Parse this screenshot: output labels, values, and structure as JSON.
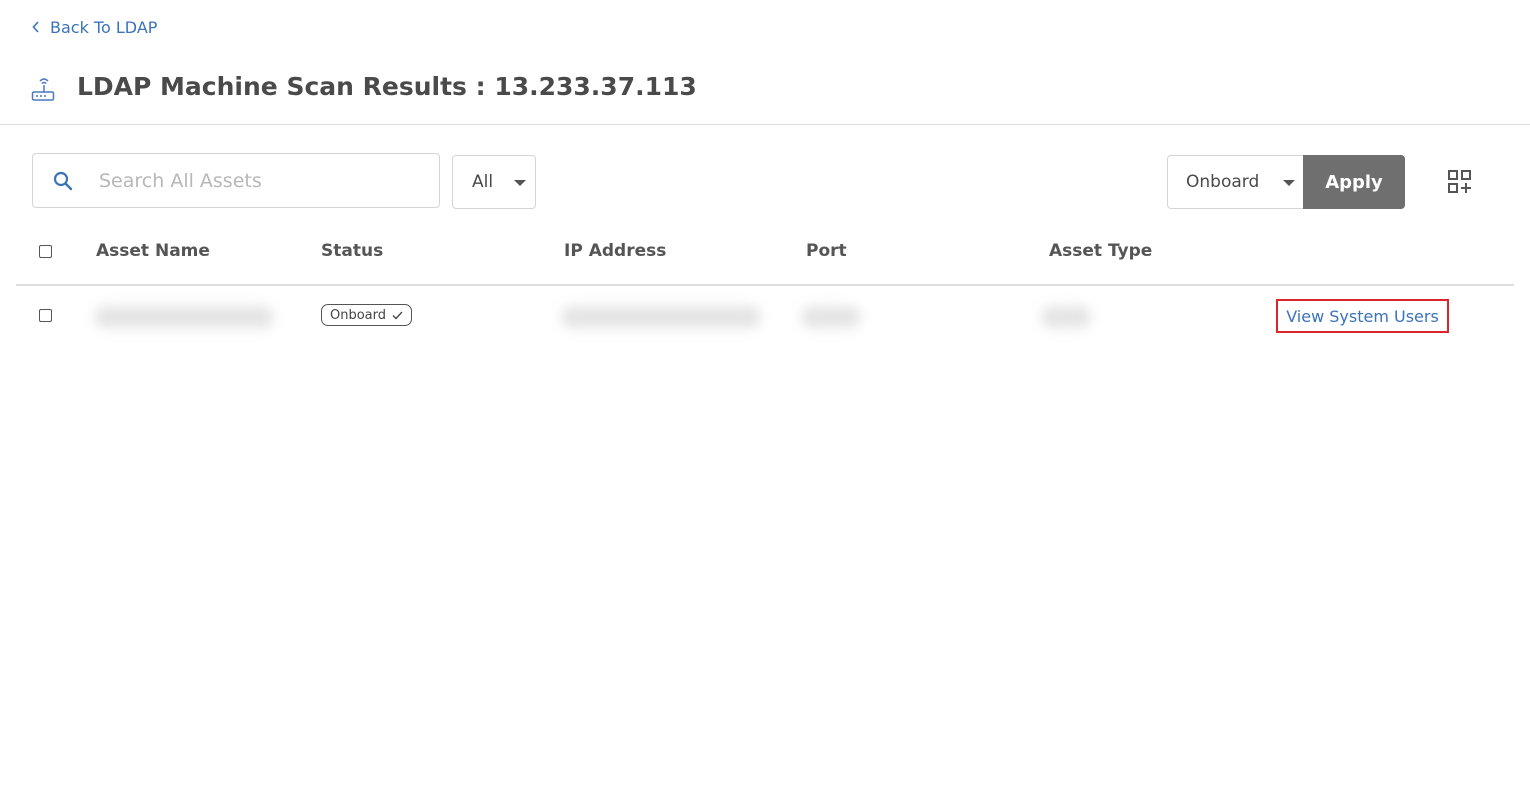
{
  "nav": {
    "back_label": "Back To LDAP"
  },
  "header": {
    "title": "LDAP Machine Scan Results : 13.233.37.113",
    "icon": "network-device-icon"
  },
  "search": {
    "placeholder": "Search All Assets",
    "value": ""
  },
  "filter": {
    "selected": "All"
  },
  "bulk_action": {
    "selected": "Onboard",
    "apply_label": "Apply"
  },
  "table": {
    "columns": [
      "Asset Name",
      "Status",
      "IP Address",
      "Port",
      "Asset Type"
    ],
    "rows": [
      {
        "status": "Onboard",
        "action_label": "View System Users"
      }
    ]
  },
  "colors": {
    "link": "#3b73b9",
    "apply_button": "#6f6f6f",
    "highlight": "#d9262d"
  }
}
